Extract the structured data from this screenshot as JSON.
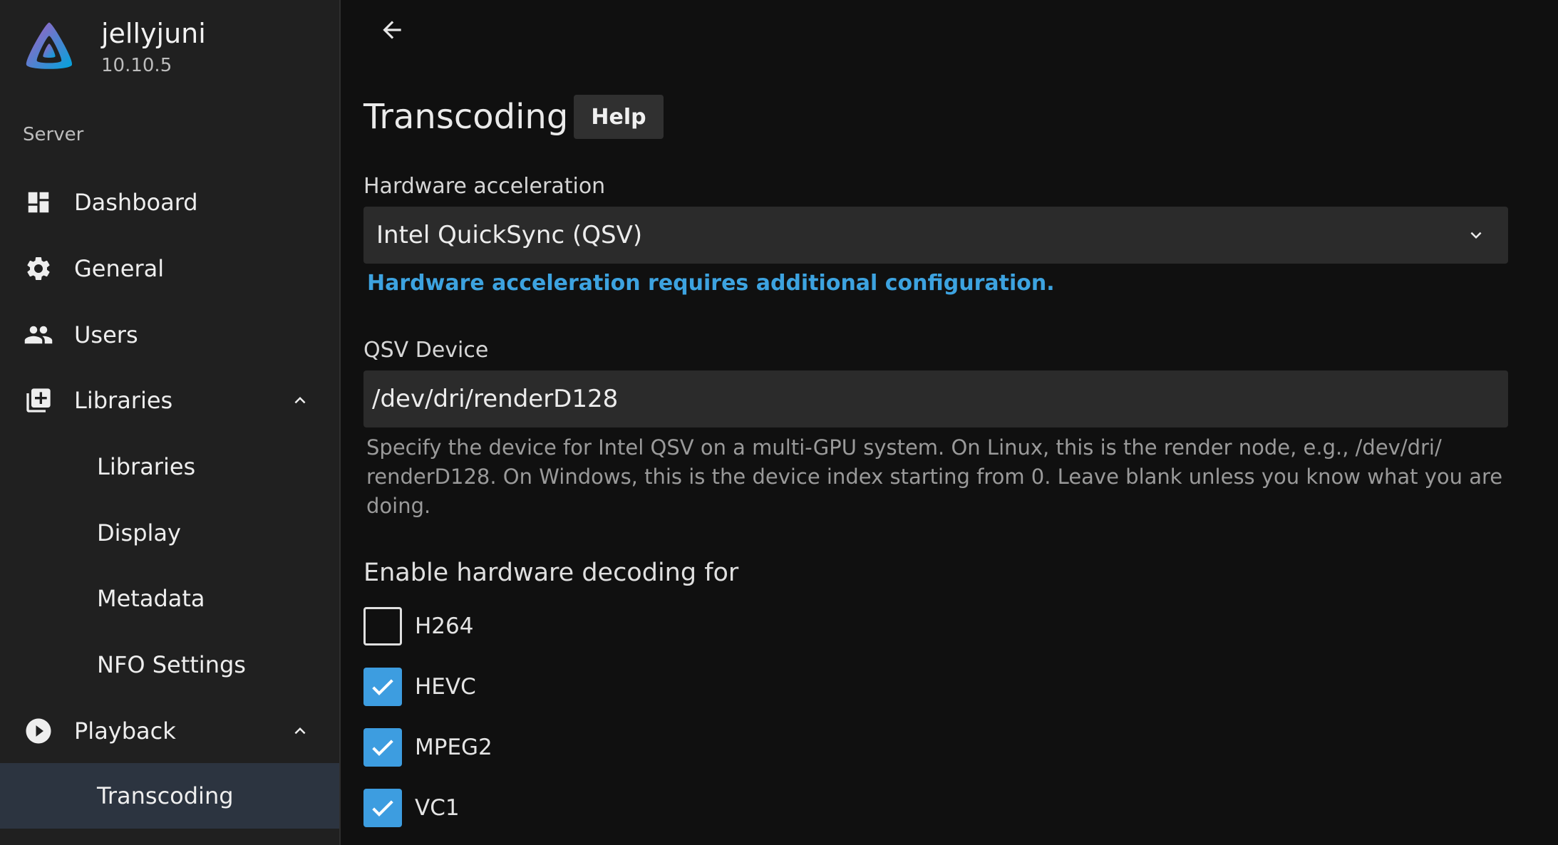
{
  "app": {
    "name": "jellyjuni",
    "version": "10.10.5"
  },
  "sidebar": {
    "section_label": "Server",
    "items": [
      {
        "label": "Dashboard",
        "icon": "dashboard-icon"
      },
      {
        "label": "General",
        "icon": "gear-icon"
      },
      {
        "label": "Users",
        "icon": "users-icon"
      },
      {
        "label": "Libraries",
        "icon": "library-add-icon",
        "expanded": true
      },
      {
        "label": "Libraries"
      },
      {
        "label": "Display"
      },
      {
        "label": "Metadata"
      },
      {
        "label": "NFO Settings"
      },
      {
        "label": "Playback",
        "icon": "play-circle-icon",
        "expanded": true
      },
      {
        "label": "Transcoding",
        "active": true
      }
    ]
  },
  "page": {
    "title": "Transcoding",
    "help_label": "Help",
    "hw_accel": {
      "label": "Hardware acceleration",
      "selected": "Intel QuickSync (QSV)",
      "link": "Hardware acceleration requires additional configuration."
    },
    "qsv_device": {
      "label": "QSV Device",
      "value": "/dev/dri/renderD128",
      "help": "Specify the device for Intel QSV on a multi-GPU system. On Linux, this is the render node, e.g., /dev/dri/ renderD128. On Windows, this is the device index starting from 0. Leave blank unless you know what you are doing."
    },
    "decoding": {
      "heading": "Enable hardware decoding for",
      "codecs": [
        {
          "label": "H264",
          "checked": false
        },
        {
          "label": "HEVC",
          "checked": true
        },
        {
          "label": "MPEG2",
          "checked": true
        },
        {
          "label": "VC1",
          "checked": true
        }
      ]
    }
  },
  "colors": {
    "accent": "#3d9de0",
    "sidebar_bg": "#202020",
    "main_bg": "#101010",
    "active_bg": "#2c3440"
  }
}
